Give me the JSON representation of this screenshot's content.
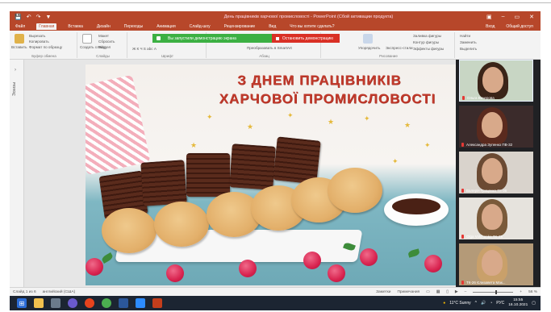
{
  "window": {
    "title": "День працівників харчової промисловості - PowerPoint (Сбой активации продукта)",
    "controls": [
      "▣",
      "–",
      "▭",
      "✕"
    ]
  },
  "qat": [
    "💾",
    "↶",
    "↷",
    "▼"
  ],
  "tabs": {
    "items": [
      "Файл",
      "Главная",
      "Вставка",
      "Дизайн",
      "Переходы",
      "Анимация",
      "Слайд-шоу",
      "Рецензирование",
      "Вид",
      "Что вы хотите сделать?"
    ],
    "active_index": 1,
    "signin": "Вход",
    "share": "Общий доступ"
  },
  "ribbon": {
    "clipboard": {
      "paste": "Вставить",
      "cut": "Вырезать",
      "copy": "Копировать",
      "format": "Формат по образцу",
      "label": "Буфер обмена"
    },
    "slides": {
      "new": "Создать слайд",
      "layout": "Макет",
      "reset": "Сбросить",
      "section": "Раздел",
      "label": "Слайды"
    },
    "font": {
      "label": "Шрифт",
      "tools": "Ж К Ч S abc А"
    },
    "paragraph": {
      "label": "Абзац",
      "convert": "Преобразовать в SmartArt"
    },
    "drawing": {
      "label": "Рисование",
      "arrange": "Упорядочить",
      "styles": "Экспресс-стили",
      "fill": "Заливка фигуры",
      "outline": "Контур фигуры",
      "effects": "Эффекты фигуры"
    },
    "editing": {
      "find": "Найти",
      "replace": "Заменить",
      "select": "Выделить"
    }
  },
  "share_banner": {
    "text": "Вы запустили демонстрацию экрана",
    "stop": "Остановить демонстрацию"
  },
  "left_pane": {
    "label": "Эскизы"
  },
  "slide": {
    "line1": "З ДНЕМ ПРАЦІВНИКІВ",
    "line2": "ХАРЧОВОЇ ПРОМИСЛОВОСТІ"
  },
  "participants": [
    {
      "name": "Ольга Вечерова",
      "hair": "#3a2418",
      "bg": "#c8d6c4"
    },
    {
      "name": "Александра Зупенко ПВ-32",
      "hair": "#5a2a1e",
      "bg": "#3b2b2b"
    },
    {
      "name": "Валерія Гриценко ТК-36",
      "hair": "#6b4a33",
      "bg": "#d9d3cc"
    },
    {
      "name": "Olga Volchenko TK-25",
      "hair": "#7a5a3a",
      "bg": "#e6e3dd"
    },
    {
      "name": "ТК-26 Єлизавета Мак...",
      "hair": "#c9a06a",
      "bg": "#b49a78"
    }
  ],
  "statusbar": {
    "slide": "Слайд 1 из 6",
    "language": "английский (США)",
    "notes": "Заметки",
    "comments": "Примечания",
    "zoom": "56 %"
  },
  "taskbar": {
    "weather": "11°C Sunny",
    "language": "РУС",
    "time": "15:55",
    "date": "16.10.2021"
  }
}
